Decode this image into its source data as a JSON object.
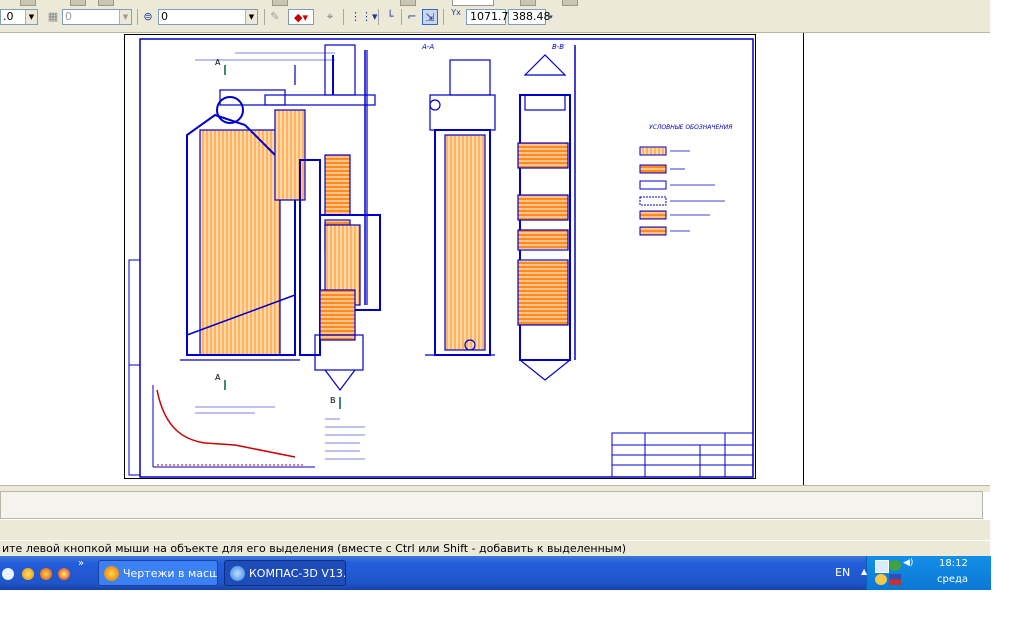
{
  "toolbar": {
    "combo1_value": ".0",
    "combo2_value": "0",
    "combo3_value": "0",
    "coord_x": "1071.7",
    "coord_y": "388.48"
  },
  "drawing": {
    "section_label_aa": "A-A",
    "section_label_bb": "B-B",
    "legend_title": "УСЛОВНЫЕ ОБОЗНАЧЕНИЯ",
    "mark_a": "A",
    "mark_b": "B"
  },
  "status_text": "ите левой кнопкой мыши на объекте для его выделения (вместе с Ctrl или Shift - добавить к выделенным)",
  "taskbar": {
    "quicklaunch_more": "»",
    "task1": "Чертежи в масш...",
    "task2": "КОМПАС-3D V13...",
    "lang": "EN",
    "time": "18:12",
    "day": "среда"
  },
  "colors": {
    "drawing_line": "#0000cc",
    "fill_orange": "#ff8a1e",
    "taskbar": "#245edb"
  }
}
